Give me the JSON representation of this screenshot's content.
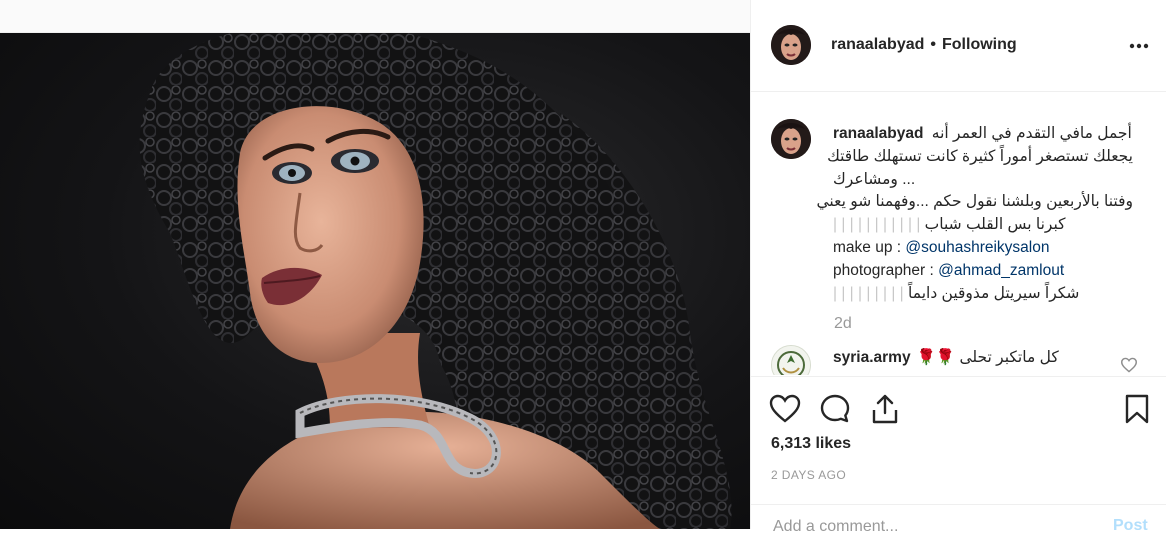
{
  "post": {
    "username": "ranaalabyad",
    "separator": "•",
    "follow_status": "Following",
    "more_icon": "more-horizontal-icon"
  },
  "caption": {
    "username": "ranaalabyad",
    "lines": [
      "أجمل مافي التقدم في العمر أنه",
      "يجعلك تستصغر أموراً كثيرة كانت تستهلك طاقتك",
      "... ومشاعرك",
      "وفتنا بالأربعين وبلشنا نقول حكم ...وفهمنا شو يعني",
      "كبرنا بس القلب شباب",
      "make up :",
      "photographer :",
      "شكراً سيريتل مذوقين دايماً"
    ],
    "bars_a": "| | | | | | | | | | |",
    "bars_b": "| | | | | | | | |",
    "makeup_mention": "@souhashreikysalon",
    "photographer_mention": "@ahmad_zamlout",
    "time": "2d"
  },
  "comment": {
    "username": "syria.army",
    "text": "كل ماتكبر تحلى 🌹🌹",
    "heart_icon": "heart-outline-icon"
  },
  "actions": {
    "like_icon": "heart-icon",
    "comment_icon": "comment-icon",
    "share_icon": "share-icon",
    "save_icon": "bookmark-icon",
    "likes": "6,313 likes",
    "date": "2 DAYS AGO"
  },
  "add_comment": {
    "placeholder": "Add a comment...",
    "post_label": "Post"
  },
  "colors": {
    "text": "#262626",
    "muted": "#999999",
    "mention": "#003569",
    "post_button": "#b2dffc",
    "border": "#efefef"
  }
}
